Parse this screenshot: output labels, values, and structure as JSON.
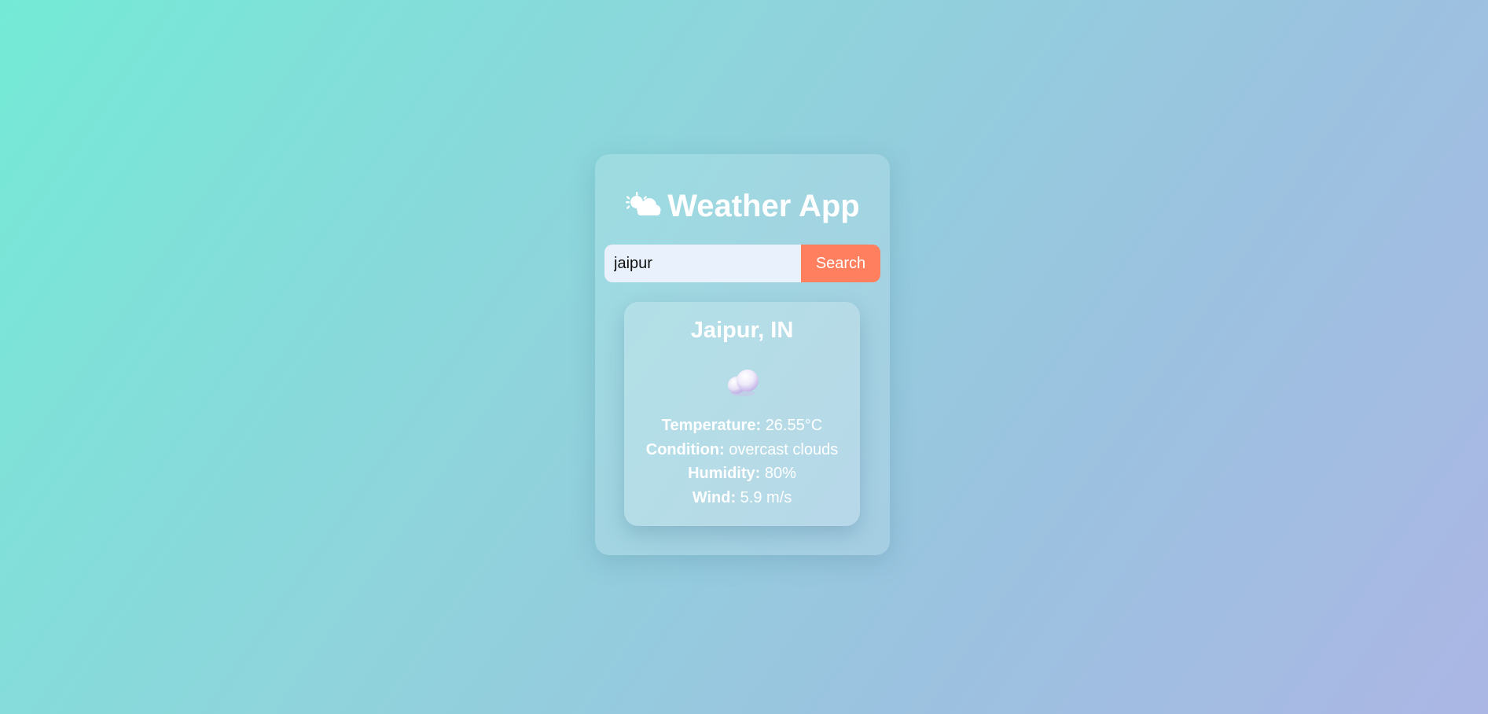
{
  "app": {
    "title": "Weather App",
    "title_icon": "sun-behind-cloud-icon"
  },
  "search": {
    "value": "jaipur",
    "placeholder": "",
    "button_label": "Search"
  },
  "result": {
    "city": "Jaipur, IN",
    "weather_icon": "clouds-icon",
    "details": [
      {
        "label": "Temperature:",
        "value": "26.55°C"
      },
      {
        "label": "Condition:",
        "value": "overcast clouds"
      },
      {
        "label": "Humidity:",
        "value": "80%"
      },
      {
        "label": "Wind:",
        "value": "5.9 m/s"
      }
    ]
  },
  "colors": {
    "background_start": "#74ead6",
    "background_end": "#abb6e4",
    "accent": "#ff7f5e",
    "input_bg": "#e9f1fc",
    "text": "#ffffff"
  }
}
